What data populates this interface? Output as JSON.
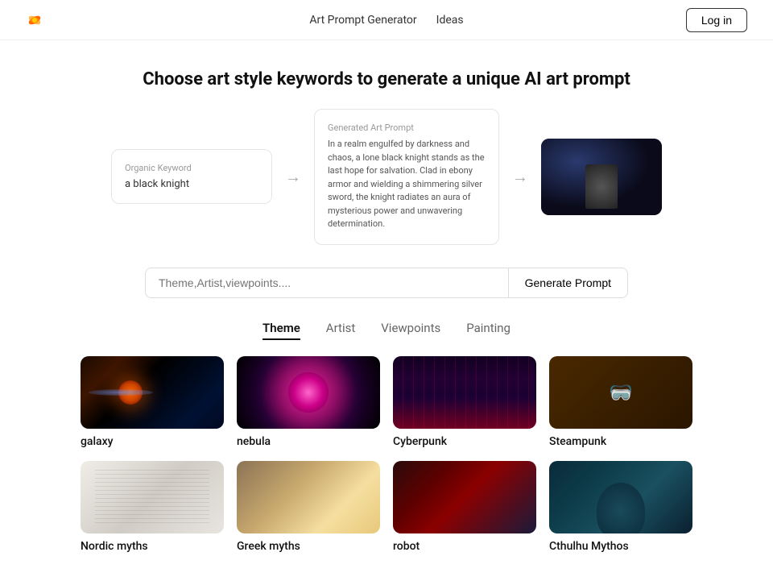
{
  "nav": {
    "links": [
      {
        "label": "Art Prompt Generator",
        "id": "art-prompt-generator"
      },
      {
        "label": "Ideas",
        "id": "ideas"
      }
    ],
    "login_label": "Log in"
  },
  "hero": {
    "title": "Choose art style keywords to generate a unique AI art prompt"
  },
  "demo": {
    "organic_keyword_label": "Organic Keyword",
    "organic_keyword_value": "a black knight",
    "arrow1": "→",
    "generated_art_prompt_label": "Generated Art Prompt",
    "generated_art_prompt_text": "In a realm engulfed by darkness and chaos, a lone black knight stands as the last hope for salvation. Clad in ebony armor and wielding a shimmering silver sword, the knight radiates an aura of mysterious power and unwavering determination.",
    "arrow2": "→"
  },
  "search": {
    "placeholder": "Theme,Artist,viewpoints....",
    "generate_button_label": "Generate Prompt"
  },
  "tabs": [
    {
      "label": "Theme",
      "active": true
    },
    {
      "label": "Artist",
      "active": false
    },
    {
      "label": "Viewpoints",
      "active": false
    },
    {
      "label": "Painting",
      "active": false
    }
  ],
  "grid_items": [
    {
      "label": "galaxy",
      "img_class": "img-galaxy",
      "id": "galaxy"
    },
    {
      "label": "nebula",
      "img_class": "img-nebula",
      "id": "nebula"
    },
    {
      "label": "Cyberpunk",
      "img_class": "img-cyberpunk",
      "id": "cyberpunk"
    },
    {
      "label": "Steampunk",
      "img_class": "img-steampunk",
      "id": "steampunk"
    },
    {
      "label": "Nordic myths",
      "img_class": "img-nordic",
      "id": "nordic-myths"
    },
    {
      "label": "Greek myths",
      "img_class": "img-greek",
      "id": "greek-myths"
    },
    {
      "label": "robot",
      "img_class": "img-robot",
      "id": "robot"
    },
    {
      "label": "Cthulhu Mythos",
      "img_class": "img-cthulhu",
      "id": "cthulhu-mythos"
    }
  ]
}
